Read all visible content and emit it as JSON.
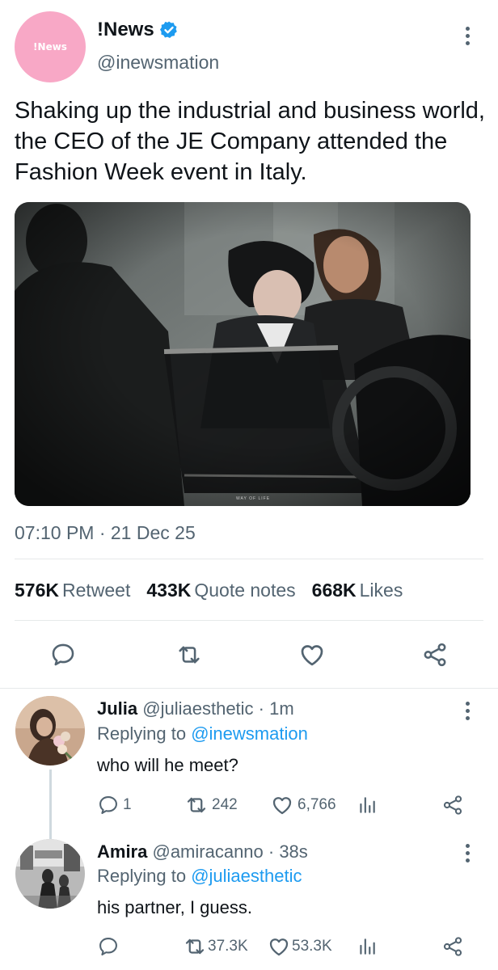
{
  "post": {
    "avatar_text": "!News",
    "display_name": "!News",
    "handle": "@inewsmation",
    "text": "Shaking up the industrial and business world, the CEO of the JE Company attended the Fashion Week event in Italy.",
    "photo_caption": "WAY OF LIFE",
    "timestamp": "07:10 PM · 21 Dec 25",
    "stats": {
      "retweets_count": "576K",
      "retweets_label": "Retweet",
      "quotes_count": "433K",
      "quotes_label": "Quote notes",
      "likes_count": "668K",
      "likes_label": "Likes"
    }
  },
  "replies": [
    {
      "name": "Julia",
      "handle_time": "@juliaesthetic · 1m",
      "replying_prefix": "Replying to ",
      "replying_to": "@inewsmation",
      "text": "who will he meet?",
      "reply_count": "1",
      "retweet_count": "242",
      "like_count": "6,766"
    },
    {
      "name": "Amira",
      "handle_time": "@amiracanno · 38s",
      "replying_prefix": "Replying to ",
      "replying_to": "@juliaesthetic",
      "text": "his partner, I guess.",
      "reply_count": "",
      "retweet_count": "37.3K",
      "like_count": "53.3K"
    }
  ],
  "icons": {
    "verified": "verified-badge-icon",
    "more": "more-vertical-icon",
    "reply": "reply-bubble-icon",
    "retweet": "retweet-icon",
    "like": "heart-icon",
    "share": "share-icon",
    "analytics": "analytics-bars-icon"
  },
  "colors": {
    "avatar_pink": "#f8a8c6",
    "verified_blue": "#1d9bf0",
    "link_blue": "#1d9bf0",
    "muted_text": "#536471",
    "primary_text": "#0f1419",
    "divider": "#e6e9ea"
  }
}
